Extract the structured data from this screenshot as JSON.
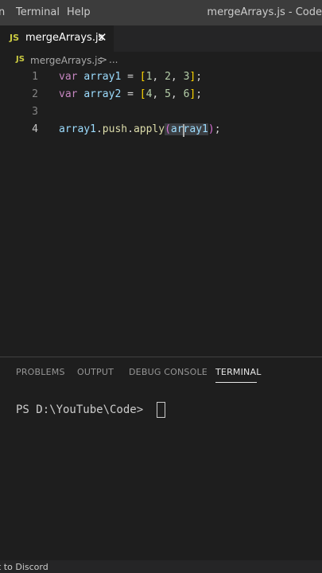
{
  "menu": {
    "items": [
      "n",
      "Terminal",
      "Help"
    ]
  },
  "window": {
    "title": "mergeArrays.js - Code"
  },
  "tabs": [
    {
      "icon": "JS",
      "label": "mergeArrays.js",
      "close": "✕"
    }
  ],
  "breadcrumb": {
    "icon": "JS",
    "file": "mergeArrays.js",
    "separator": ">",
    "more": "..."
  },
  "editor": {
    "line_numbers": [
      "1",
      "2",
      "3",
      "4"
    ],
    "active_line": "4",
    "lines": {
      "1": {
        "kw": "var",
        "name": "array1",
        "eq": "=",
        "open": "[",
        "values": [
          "1",
          "2",
          "3"
        ],
        "close": "]",
        "end": ";"
      },
      "2": {
        "kw": "var",
        "name": "array2",
        "eq": "=",
        "open": "[",
        "values": [
          "4",
          "5",
          "6"
        ],
        "close": "]",
        "end": ";"
      },
      "4": {
        "obj": "array1",
        "dot1": ".",
        "method1": "push",
        "dot2": ".",
        "method2": "apply",
        "open": "(",
        "arg": "array1",
        "close": ")",
        "end": ";"
      }
    }
  },
  "panel": {
    "tabs": [
      "PROBLEMS",
      "OUTPUT",
      "DEBUG CONSOLE",
      "TERMINAL"
    ],
    "active_tab": "TERMINAL",
    "terminal_prompt": "PS D:\\YouTube\\Code>"
  },
  "statusbar": {
    "text": "t to Discord"
  },
  "colors": {
    "keyword": "#c586c0",
    "variable": "#9cdcfe",
    "number": "#b5cea8",
    "function": "#dcdcaa",
    "bracket": "#ffd700",
    "bracket_nested": "#da70d6",
    "js_icon": "#cbcb41"
  }
}
